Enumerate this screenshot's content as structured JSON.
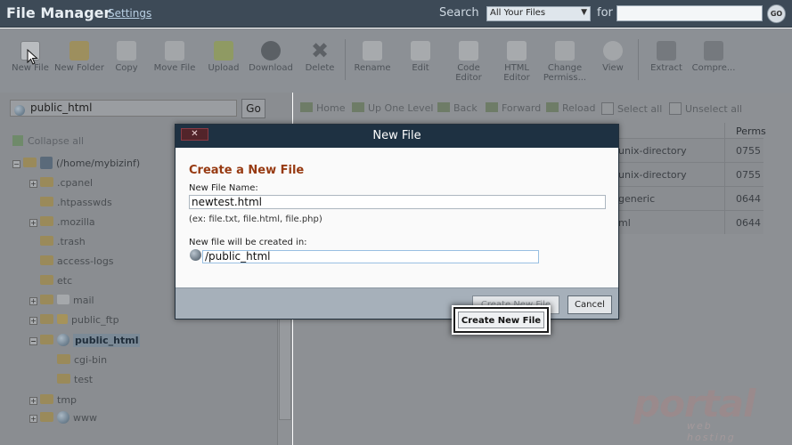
{
  "header": {
    "title": "File Manager",
    "settings": "Settings",
    "search_label": "Search",
    "search_scope": "All Your Files",
    "for_label": "for",
    "go_label": "GO"
  },
  "toolbar": {
    "items": [
      {
        "label": "New File",
        "icon": "new-file-icon"
      },
      {
        "label": "New Folder",
        "icon": "new-folder-icon"
      },
      {
        "label": "Copy",
        "icon": "copy-icon"
      },
      {
        "label": "Move File",
        "icon": "move-file-icon"
      },
      {
        "label": "Upload",
        "icon": "upload-icon"
      },
      {
        "label": "Download",
        "icon": "download-icon"
      },
      {
        "label": "Delete",
        "icon": "delete-icon"
      },
      {
        "label": "Rename",
        "icon": "rename-icon"
      },
      {
        "label": "Edit",
        "icon": "edit-icon"
      },
      {
        "label": "Code Editor",
        "icon": "code-editor-icon"
      },
      {
        "label": "HTML Editor",
        "icon": "html-editor-icon"
      },
      {
        "label": "Change Permiss...",
        "icon": "permissions-icon"
      },
      {
        "label": "View",
        "icon": "view-icon"
      },
      {
        "label": "Extract",
        "icon": "extract-icon"
      },
      {
        "label": "Compre...",
        "icon": "compress-icon"
      }
    ]
  },
  "left": {
    "path_value": "public_html",
    "go": "Go",
    "collapse_all": "Collapse all",
    "tree": [
      {
        "label": "(/home/mybizinf)",
        "kind": "home"
      },
      {
        "label": ".cpanel",
        "kind": "folder"
      },
      {
        "label": ".htpasswds",
        "kind": "folder"
      },
      {
        "label": ".mozilla",
        "kind": "folder"
      },
      {
        "label": ".trash",
        "kind": "folder"
      },
      {
        "label": "access-logs",
        "kind": "folder"
      },
      {
        "label": "etc",
        "kind": "folder"
      },
      {
        "label": "mail",
        "kind": "folder"
      },
      {
        "label": "public_ftp",
        "kind": "folder"
      },
      {
        "label": "public_html",
        "kind": "globe"
      },
      {
        "label": "cgi-bin",
        "kind": "folder"
      },
      {
        "label": "test",
        "kind": "folder"
      },
      {
        "label": "tmp",
        "kind": "folder"
      },
      {
        "label": "www",
        "kind": "globe"
      }
    ]
  },
  "right": {
    "nav": {
      "home": "Home",
      "up": "Up One Level",
      "back": "Back",
      "forward": "Forward",
      "reload": "Reload",
      "select_all": "Select all",
      "unselect_all": "Unselect all"
    },
    "perms_header": "Perms",
    "rows": [
      {
        "type": "unix-directory",
        "perms": "0755"
      },
      {
        "type": "unix-directory",
        "perms": "0755"
      },
      {
        "type": "generic",
        "perms": "0644"
      },
      {
        "type": "ml",
        "perms": "0644"
      }
    ]
  },
  "modal": {
    "title": "New File",
    "close": "✕",
    "heading": "Create a New File",
    "name_label": "New File Name:",
    "name_value": "newtest.html",
    "hint": "(ex: file.txt, file.html, file.php)",
    "dir_label": "New file will be created in:",
    "dir_value": "/public_html",
    "create": "Create New File",
    "cancel": "Cancel"
  },
  "watermark": {
    "brand": "portal",
    "tagline": "web hosting"
  }
}
